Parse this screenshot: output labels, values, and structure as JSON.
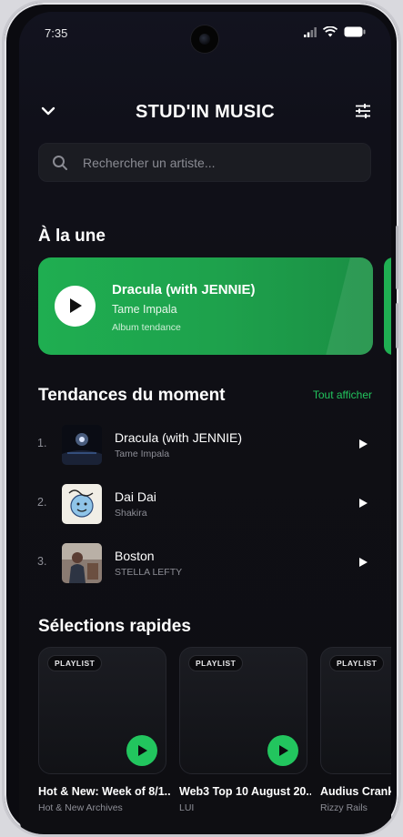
{
  "status_bar": {
    "time": "7:35"
  },
  "header": {
    "title": "STUD'IN MUSIC"
  },
  "search": {
    "placeholder": "Rechercher un artiste..."
  },
  "featured_section": {
    "title": "À la une",
    "card": {
      "title": "Dracula (with JENNIE)",
      "artist": "Tame Impala",
      "tag": "Album tendance"
    }
  },
  "trends": {
    "title": "Tendances du moment",
    "see_all": "Tout afficher",
    "items": [
      {
        "rank": "1.",
        "title": "Dracula (with JENNIE)",
        "artist": "Tame Impala"
      },
      {
        "rank": "2.",
        "title": "Dai Dai",
        "artist": "Shakira"
      },
      {
        "rank": "3.",
        "title": "Boston",
        "artist": "STELLA LEFTY"
      }
    ]
  },
  "quick": {
    "title": "Sélections rapides",
    "items": [
      {
        "badge": "PLAYLIST",
        "title": "Hot & New: Week of 8/1...",
        "subtitle": "Hot & New Archives"
      },
      {
        "badge": "PLAYLIST",
        "title": "Web3 Top 10 August 20...",
        "subtitle": "LUI"
      },
      {
        "badge": "PLAYLIST",
        "title": "Audius Cranke",
        "subtitle": "Rizzy Rails"
      }
    ]
  },
  "colors": {
    "accent": "#22c55e",
    "background": "#0e0e12",
    "card": "#1b1c22"
  }
}
